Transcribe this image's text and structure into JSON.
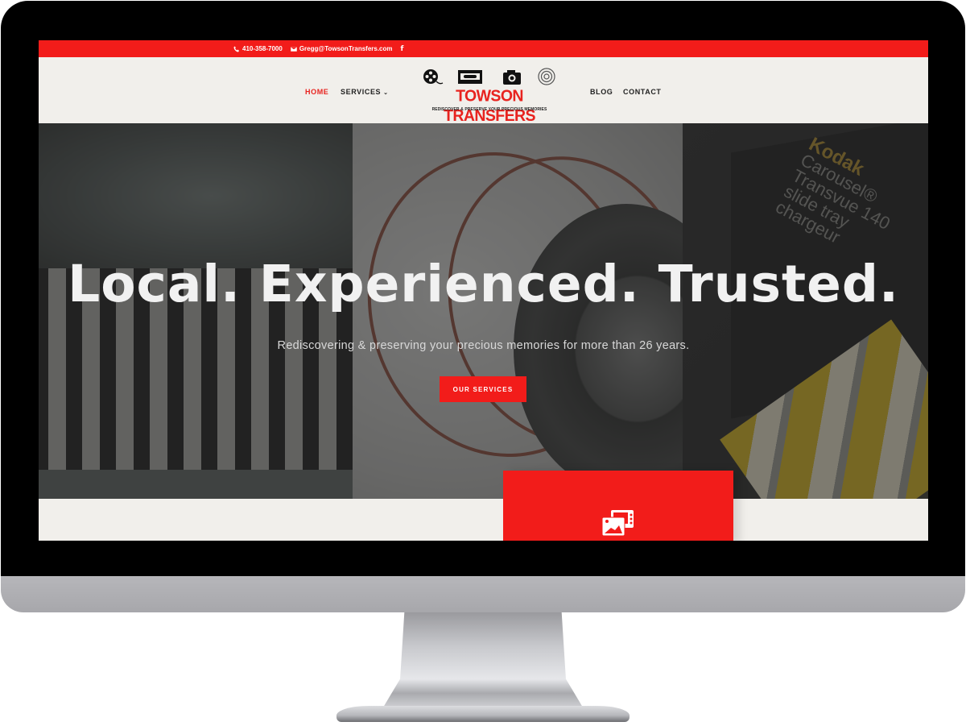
{
  "colors": {
    "accent": "#f21c1a",
    "nav_text": "#222222",
    "page_bg": "#f1efeb"
  },
  "topbar": {
    "phone_icon": "phone-icon",
    "phone": "410-358-7000",
    "email_icon": "envelope-icon",
    "email": "Gregg@TowsonTransfers.com",
    "social_icon": "facebook-icon",
    "social_label": "f"
  },
  "nav": {
    "left": [
      {
        "label": "HOME",
        "active": true
      },
      {
        "label": "SERVICES",
        "has_dropdown": true,
        "chevron": "⌄"
      }
    ],
    "right": [
      {
        "label": "BLOG"
      },
      {
        "label": "CONTACT"
      }
    ]
  },
  "logo": {
    "icons": [
      "film-reel-icon",
      "cassette-icon",
      "camera-icon",
      "disc-icon"
    ],
    "title": "TOWSON TRANSFERS",
    "tagline": "REDISCOVER & PRESERVE YOUR PRECIOUS MEMORIES"
  },
  "hero": {
    "title": "Local. Experienced. Trusted.",
    "subtitle": "Rediscovering & preserving your precious memories for more than 26 years.",
    "button_label": "OUR SERVICES",
    "background_panels": [
      "vhs-tapes-photo",
      "film-reel-photo",
      "kodak-slide-tray-photo"
    ],
    "kodak_text": {
      "brand": "Kodak",
      "lines": [
        "Carousel®",
        "Transvue 140",
        "slide tray",
        "chargeur"
      ]
    }
  },
  "service_card": {
    "icon": "photo-film-icon"
  }
}
